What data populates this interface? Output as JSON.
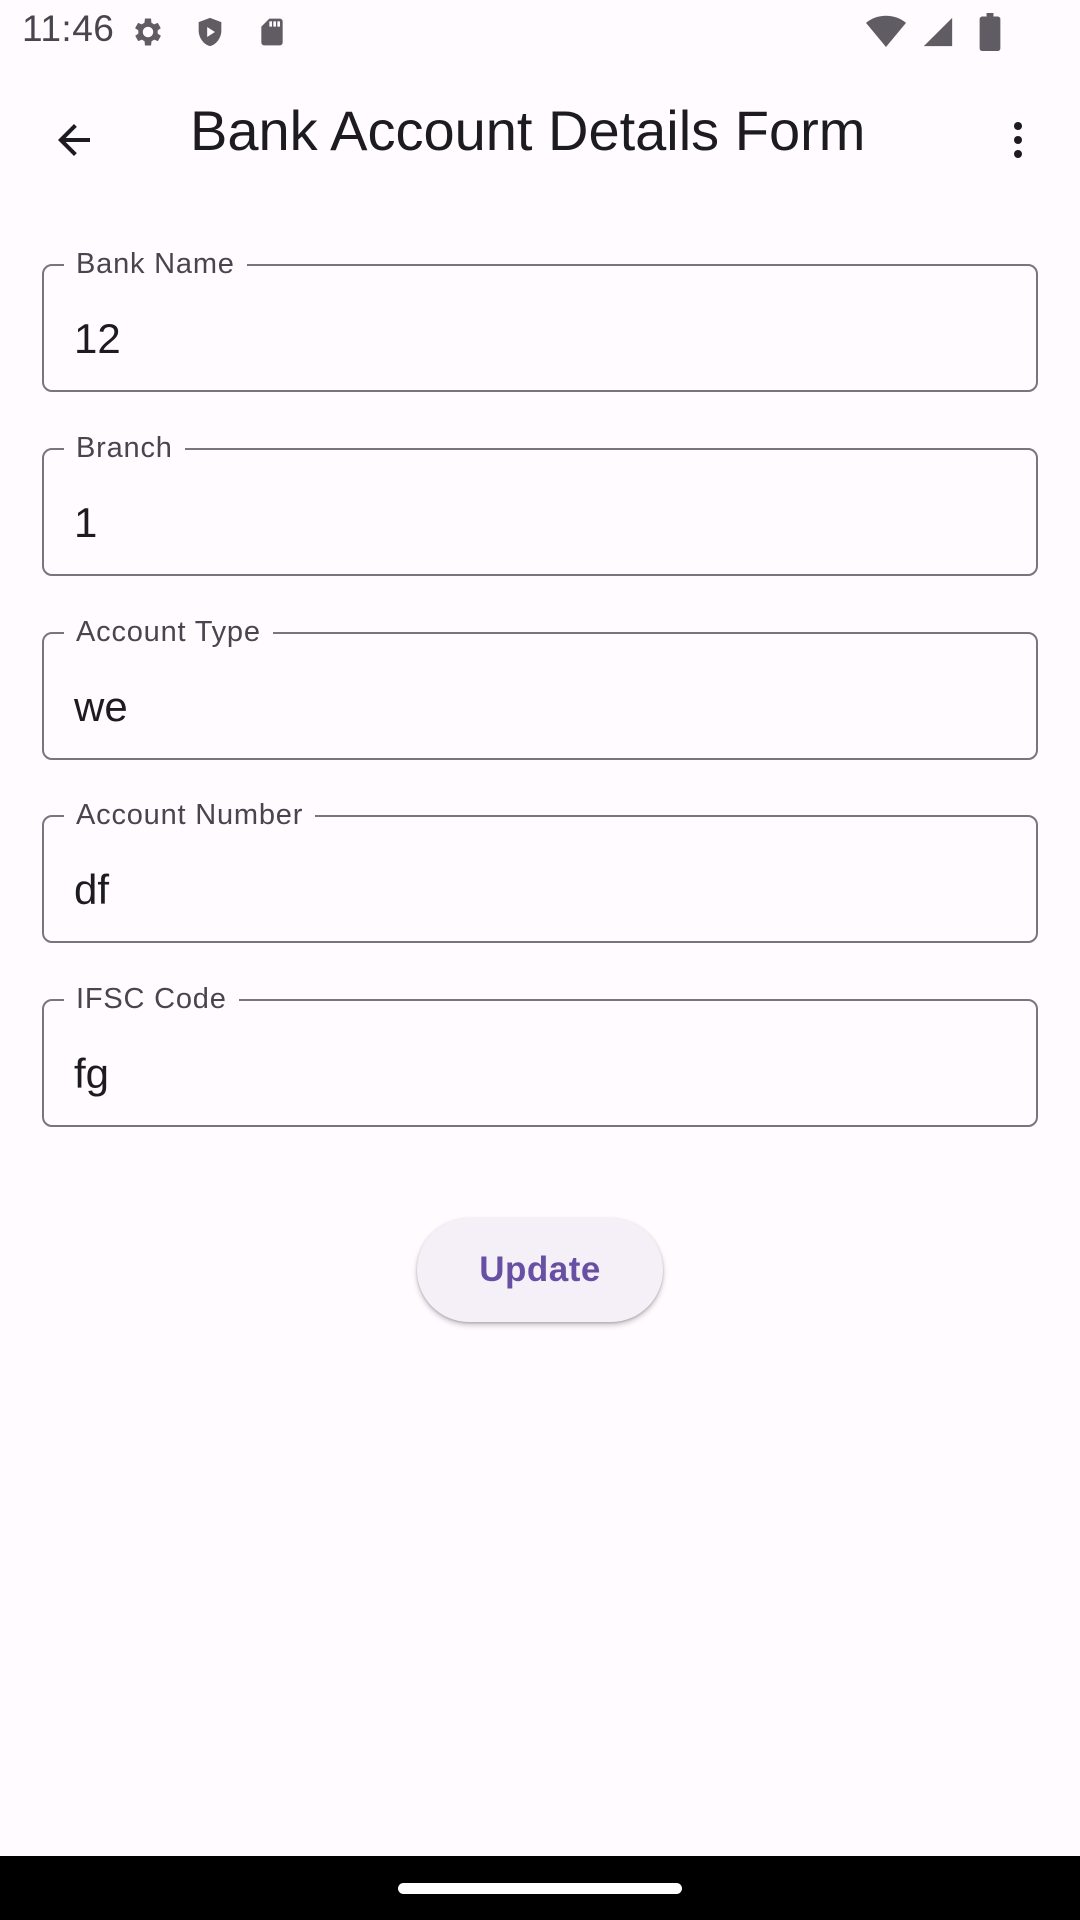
{
  "status_bar": {
    "time": "11:46",
    "left_icons": [
      "settings-icon",
      "shield-icon",
      "sd-card-icon"
    ],
    "right_icons": [
      "wifi-icon",
      "signal-icon",
      "battery-icon"
    ]
  },
  "app_bar": {
    "title": "Bank Account Details Form",
    "back_icon": "arrow-back-icon",
    "menu_icon": "more-vert-icon"
  },
  "form": {
    "fields": [
      {
        "label": "Bank Name",
        "value": "12"
      },
      {
        "label": "Branch",
        "value": "1"
      },
      {
        "label": "Account Type",
        "value": "we"
      },
      {
        "label": "Account Number",
        "value": "df"
      },
      {
        "label": "IFSC Code",
        "value": "fg"
      }
    ],
    "submit_label": "Update"
  },
  "colors": {
    "background": "#fffbfe",
    "primary": "#6750a4",
    "outline": "#79747e",
    "button_surface": "#f5eff7"
  }
}
